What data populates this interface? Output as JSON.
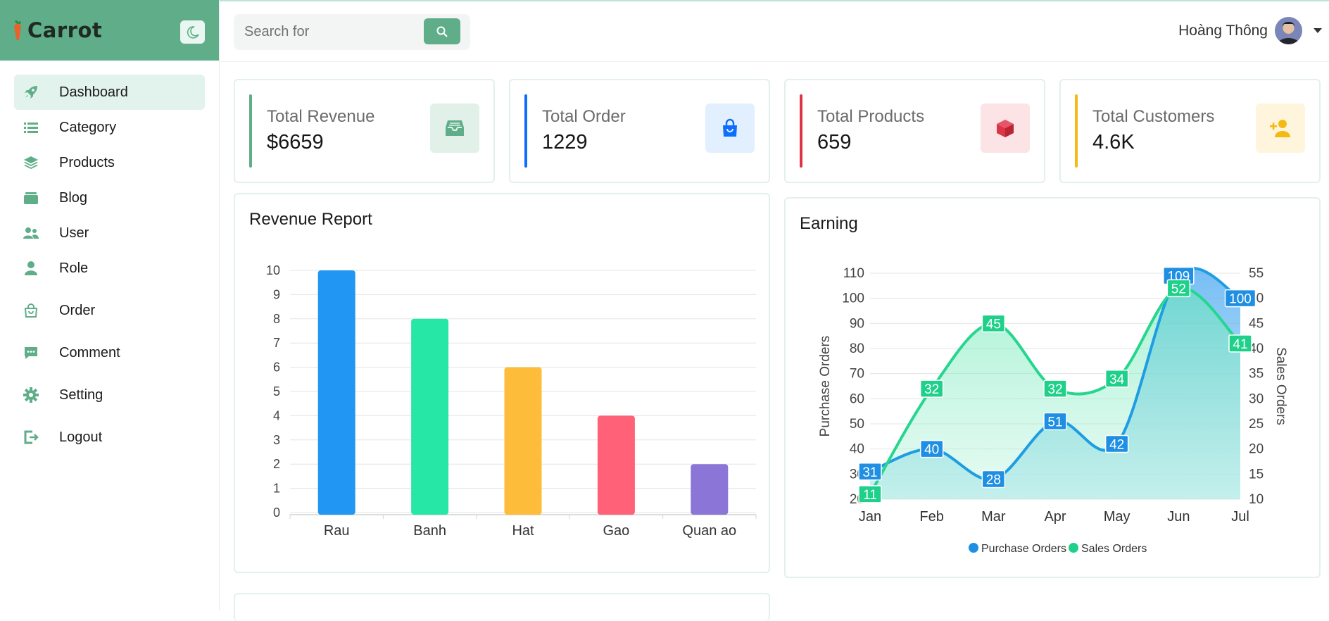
{
  "brand": {
    "name": "Carrot"
  },
  "sidebar": {
    "items": [
      {
        "label": "Dashboard",
        "icon": "rocket-icon",
        "active": true
      },
      {
        "label": "Category",
        "icon": "list-icon"
      },
      {
        "label": "Products",
        "icon": "layers-icon"
      },
      {
        "label": "Blog",
        "icon": "folder-icon"
      },
      {
        "label": "User",
        "icon": "users-icon"
      },
      {
        "label": "Role",
        "icon": "person-icon"
      },
      {
        "label": "Order",
        "icon": "shopping-bag-icon"
      },
      {
        "label": "Comment",
        "icon": "comment-icon"
      },
      {
        "label": "Setting",
        "icon": "gear-icon"
      },
      {
        "label": "Logout",
        "icon": "logout-icon"
      }
    ]
  },
  "search": {
    "placeholder": "Search for",
    "value": ""
  },
  "user": {
    "name": "Hoàng Thông"
  },
  "stats": [
    {
      "label": "Total Revenue",
      "value": "$6659",
      "color": "#5fae89",
      "icon": "inbox-icon"
    },
    {
      "label": "Total Order",
      "value": "1229",
      "color": "#0d6efd",
      "icon": "shopping-bag-icon"
    },
    {
      "label": "Total Products",
      "value": "659",
      "color": "#dc3545",
      "icon": "cube-icon"
    },
    {
      "label": "Total Customers",
      "value": "4.6K",
      "color": "#f5b915",
      "icon": "user-plus-icon"
    }
  ],
  "revenue": {
    "title": "Revenue Report"
  },
  "earning": {
    "title": "Earning"
  },
  "chart_data": [
    {
      "type": "bar",
      "title": "Revenue Report",
      "categories": [
        "Rau",
        "Banh",
        "Hat",
        "Gao",
        "Quan ao"
      ],
      "values": [
        10,
        8,
        6,
        4,
        2
      ],
      "colors": [
        "#2196f3",
        "#26e7a6",
        "#febc3b",
        "#ff6178",
        "#8b75d7"
      ],
      "ylim": [
        0,
        10
      ],
      "yticks": [
        0,
        1,
        2,
        3,
        4,
        5,
        6,
        7,
        8,
        9,
        10
      ],
      "grid": true
    },
    {
      "type": "area",
      "title": "Earning",
      "categories": [
        "Jan",
        "Feb",
        "Mar",
        "Apr",
        "May",
        "Jun",
        "Jul"
      ],
      "series": [
        {
          "name": "Purchase Orders",
          "axis": "left",
          "values": [
            31,
            40,
            28,
            51,
            42,
            109,
            100
          ],
          "color": "#1e9de3"
        },
        {
          "name": "Sales Orders",
          "axis": "right",
          "values": [
            11,
            32,
            45,
            32,
            34,
            52,
            41
          ],
          "color": "#26d68f"
        }
      ],
      "y_left": {
        "label": "Purchase Orders",
        "range": [
          20,
          110
        ],
        "ticks": [
          20,
          30,
          40,
          50,
          60,
          70,
          80,
          90,
          100,
          110
        ]
      },
      "y_right": {
        "label": "Sales Orders",
        "range": [
          10,
          55
        ],
        "ticks": [
          10,
          15,
          20,
          25,
          30,
          35,
          40,
          45,
          50,
          55
        ]
      },
      "legend": "bottom",
      "grid": true
    }
  ]
}
